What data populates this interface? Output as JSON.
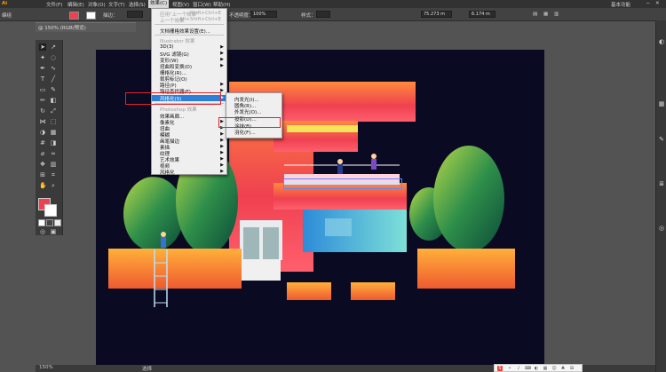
{
  "menubar": {
    "logo": "Ai",
    "items": [
      "文件(F)",
      "编辑(E)",
      "对象(O)",
      "文字(T)",
      "选择(S)",
      "效果(C)",
      "视图(V)",
      "窗口(W)",
      "帮助(H)"
    ],
    "workspace": "基本功能"
  },
  "controlbar": {
    "object_label": "编组",
    "stroke_label": "描边：",
    "opacity_label": "不透明度：",
    "opacity_value": "100%",
    "style_label": "样式：",
    "x_value": "75.273 m",
    "w_value": "6.174 m"
  },
  "doc_tab": {
    "label": "@ 150% (RGB/预览)",
    "close_icon": "close-icon"
  },
  "effect_menu": {
    "top_items": [
      {
        "label": "应用\"上一个效果\"",
        "shortcut": "Shift+Ctrl+E",
        "enabled": false
      },
      {
        "label": "上一个效果",
        "shortcut": "Alt+Shift+Ctrl+E",
        "enabled": false
      }
    ],
    "doc_raster": "文档栅格效果设置(E)...",
    "illustrator_header": "Illustrator 效果",
    "illustrator_items": [
      "3D(3)",
      "SVG 滤镜(G)",
      "变形(W)",
      "扭曲和变换(D)",
      "栅格化(R)...",
      "裁剪标记(O)",
      "路径(P)",
      "路径查找器(F)",
      "风格化(S)"
    ],
    "photoshop_header": "Photoshop 效果",
    "photoshop_items": [
      "效果画廊...",
      "像素化",
      "扭曲",
      "模糊",
      "画笔描边",
      "素描",
      "纹理",
      "艺术效果",
      "视频",
      "风格化"
    ]
  },
  "stylize_submenu": {
    "items": [
      "内发光(I)...",
      "圆角(R)...",
      "外发光(O)...",
      "投影(D)...",
      "涂抹(B)...",
      "羽化(F)..."
    ],
    "selected_index": 3
  },
  "status_bar": {
    "zoom": "150%",
    "tool_name": "选择"
  },
  "colors": {
    "fill": "#ef4150",
    "menu_highlight": "#2d7fd8",
    "annotation_red": "#e0232b",
    "artboard_bg": "#0a0a23"
  }
}
